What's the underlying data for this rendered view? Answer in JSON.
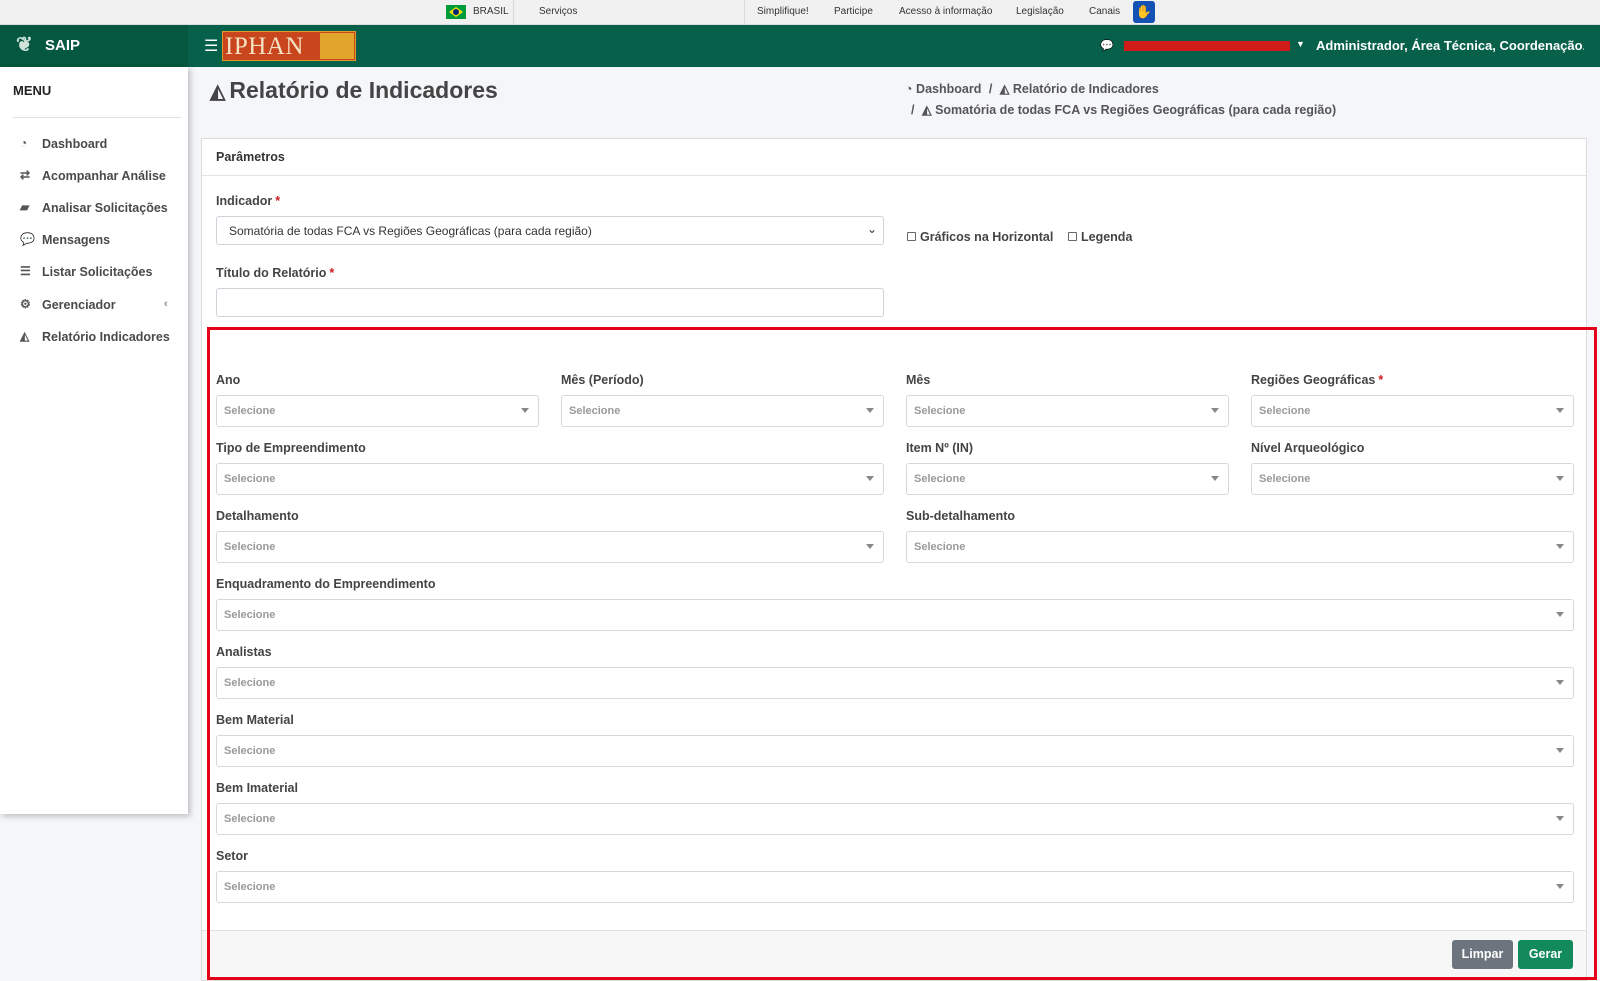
{
  "gov_bar": {
    "country": "BRASIL",
    "links": [
      "Serviços",
      "Simplifique!",
      "Participe",
      "Acesso à informação",
      "Legislação",
      "Canais"
    ]
  },
  "topnav": {
    "app_name": "SAIP",
    "logo_text": "IPHAN",
    "user_label": "Administrador, Área Técnica, Coordenação..."
  },
  "sidebar": {
    "heading": "MENU",
    "items": [
      {
        "label": "Dashboard",
        "icon": "tachometer-icon"
      },
      {
        "label": "Acompanhar Análise",
        "icon": "exchange-icon"
      },
      {
        "label": "Analisar Solicitações",
        "icon": "book-icon"
      },
      {
        "label": "Mensagens",
        "icon": "comments-icon"
      },
      {
        "label": "Listar Solicitações",
        "icon": "list-icon"
      },
      {
        "label": "Gerenciador",
        "icon": "cogs-icon"
      },
      {
        "label": "Relatório Indicadores",
        "icon": "area-chart-icon"
      }
    ]
  },
  "page": {
    "title": "Relatório de Indicadores",
    "breadcrumb": [
      "Dashboard",
      "Relatório de Indicadores",
      "Somatória de todas FCA vs Regiões Geográficas (para cada região)"
    ]
  },
  "params": {
    "header": "Parâmetros",
    "indicador_label": "Indicador",
    "indicador_value": "Somatória de todas FCA vs Regiões Geográficas (para cada região)",
    "horizontal_label": "Gráficos na Horizontal",
    "legenda_label": "Legenda",
    "titulo_label": "Título do Relatório",
    "titulo_value": ""
  },
  "filters": {
    "placeholder": "Selecione",
    "ano": "Ano",
    "mes_periodo": "Mês (Período)",
    "mes": "Mês",
    "regioes": "Regiões Geográficas",
    "tipo": "Tipo de Empreendimento",
    "item": "Item Nº (IN)",
    "nivel": "Nível Arqueológico",
    "detalhamento": "Detalhamento",
    "subdetalhamento": "Sub-detalhamento",
    "enquadramento": "Enquadramento do Empreendimento",
    "analistas": "Analistas",
    "bem_material": "Bem Material",
    "bem_imaterial": "Bem Imaterial",
    "setor": "Setor"
  },
  "actions": {
    "limpar": "Limpar",
    "gerar": "Gerar"
  },
  "colors": {
    "topbar": "#07604a",
    "highlight": "#e4001b",
    "gerar": "#138a5c",
    "limpar": "#6c757d"
  }
}
